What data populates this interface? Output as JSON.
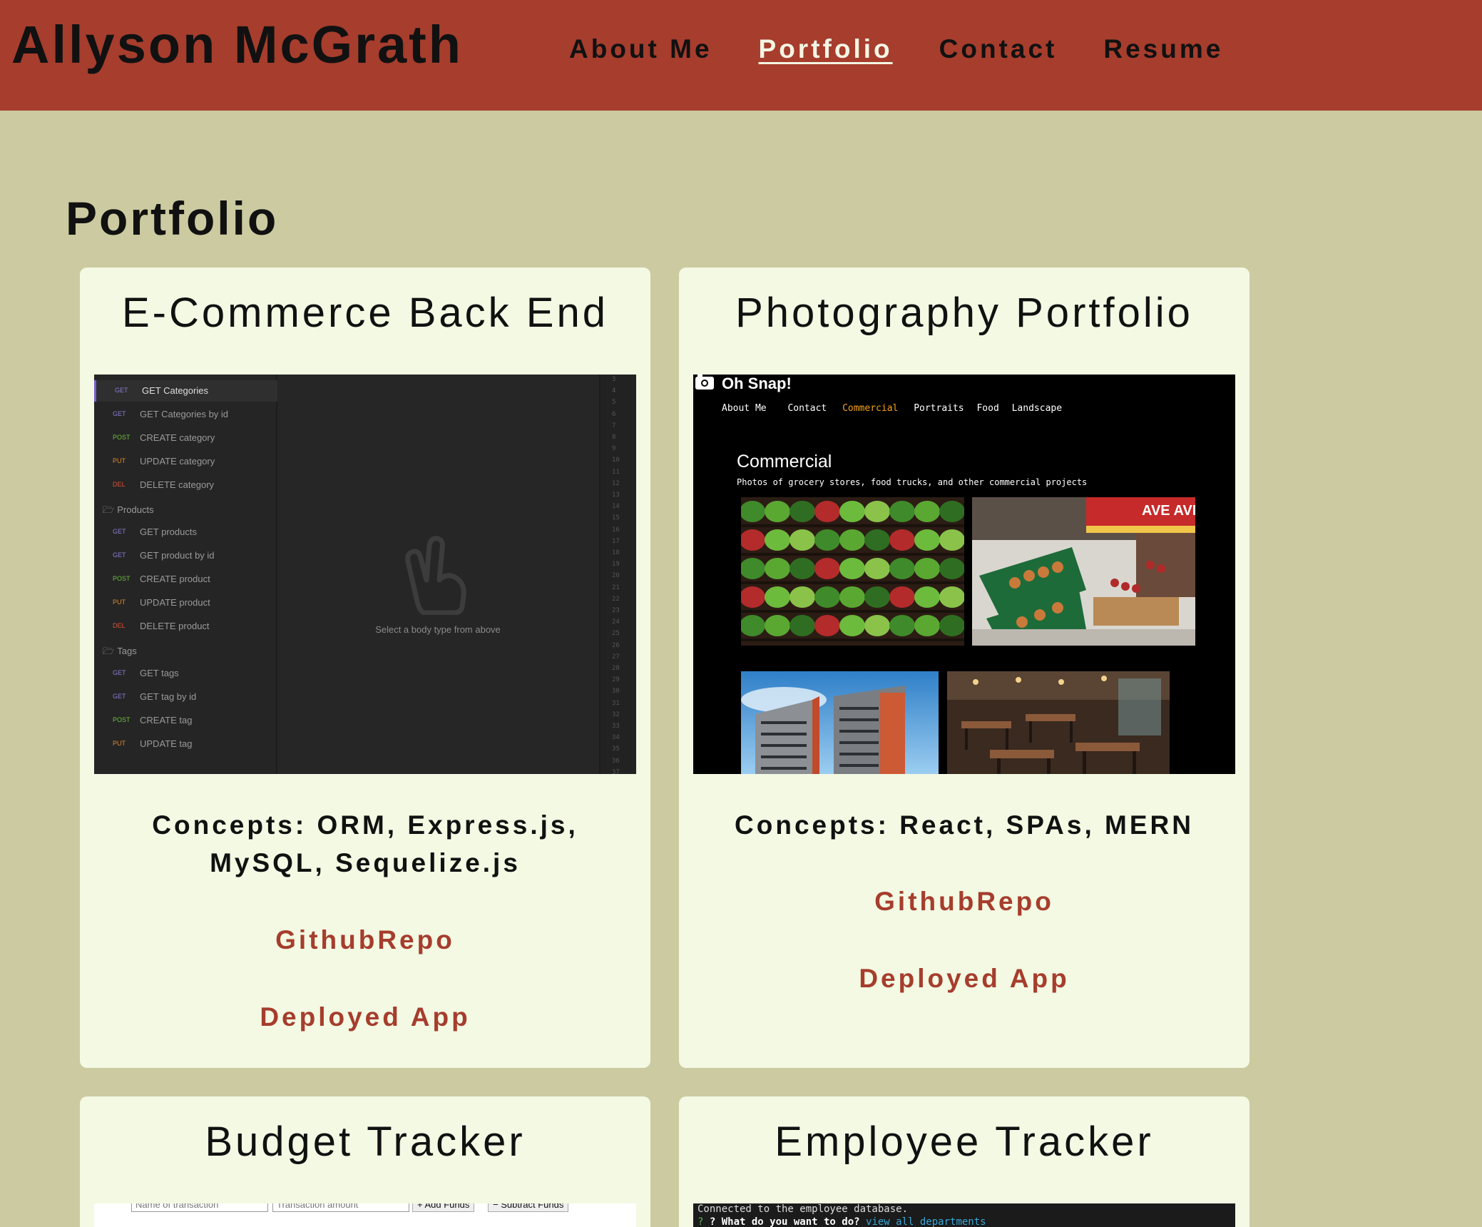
{
  "header": {
    "brand": "Allyson McGrath",
    "nav": [
      "About Me",
      "Portfolio",
      "Contact",
      "Resume"
    ],
    "active_nav": "Portfolio",
    "bg_color": "#a63d2d"
  },
  "section_title": "Portfolio",
  "cards": [
    {
      "title": "E-Commerce Back End",
      "concepts": "Concepts: ORM, Express.js, MySQL, Sequelize.js",
      "links": [
        "GithubRepo",
        "Deployed App"
      ],
      "screenshot": {
        "rows": [
          {
            "method": "GET",
            "label": "GET Categories"
          },
          {
            "method": "GET",
            "label": "GET Categories by id"
          },
          {
            "method": "POST",
            "label": "CREATE category"
          },
          {
            "method": "PUT",
            "label": "UPDATE category"
          },
          {
            "method": "DEL",
            "label": "DELETE category"
          },
          {
            "folder": "Products"
          },
          {
            "method": "GET",
            "label": "GET products"
          },
          {
            "method": "GET",
            "label": "GET product by id"
          },
          {
            "method": "POST",
            "label": "CREATE product"
          },
          {
            "method": "PUT",
            "label": "UPDATE product"
          },
          {
            "method": "DEL",
            "label": "DELETE product"
          },
          {
            "folder": "Tags"
          },
          {
            "method": "GET",
            "label": "GET tags"
          },
          {
            "method": "GET",
            "label": "GET tag by id"
          },
          {
            "method": "POST",
            "label": "CREATE tag"
          },
          {
            "method": "PUT",
            "label": "UPDATE tag"
          }
        ],
        "hint": "Select a body type from above"
      }
    },
    {
      "title": "Photography Portfolio",
      "concepts": "Concepts: React, SPAs, MERN",
      "links": [
        "GithubRepo",
        "Deployed App"
      ],
      "screenshot": {
        "logo": "Oh Snap!",
        "nav": [
          "About Me",
          "Contact",
          "Commercial",
          "Portraits",
          "Food",
          "Landscape"
        ],
        "active_nav": "Commercial",
        "heading": "Commercial",
        "subtitle": "Photos of grocery stores, food trucks, and other commercial projects",
        "sign_text": "AVE AVE"
      }
    },
    {
      "title": "Budget Tracker",
      "screenshot": {
        "name_placeholder": "Name of transaction",
        "amount_placeholder": "Transaction amount",
        "add_label": "+ Add Funds",
        "subtract_label": "− Subtract Funds"
      }
    },
    {
      "title": "Employee Tracker",
      "screenshot": {
        "line1": "Connected to the employee database.",
        "prompt": "? What do you want to do?",
        "answer": "view all departments"
      }
    }
  ],
  "colors": {
    "page_bg": "#cccaa0",
    "card_bg": "#f3f9e3",
    "link": "#a63d2d"
  }
}
